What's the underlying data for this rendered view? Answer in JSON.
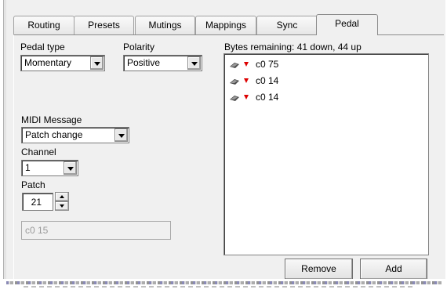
{
  "tabs": [
    {
      "label": "Routing",
      "active": false
    },
    {
      "label": "Presets",
      "active": false
    },
    {
      "label": "Mutings",
      "active": false
    },
    {
      "label": "Mappings",
      "active": false
    },
    {
      "label": "Sync",
      "active": false
    },
    {
      "label": "Pedal",
      "active": true
    }
  ],
  "pedal_type": {
    "label": "Pedal type",
    "value": "Momentary"
  },
  "polarity": {
    "label": "Polarity",
    "value": "Positive"
  },
  "midi_message": {
    "label": "MIDI Message",
    "value": "Patch change"
  },
  "channel": {
    "label": "Channel",
    "value": "1"
  },
  "patch": {
    "label": "Patch",
    "value": "21"
  },
  "output_preview": "c0 15",
  "bytes": {
    "label": "Bytes remaining: 41 down, 44 up",
    "items": [
      "c0 75",
      "c0 14",
      "c0 14"
    ]
  },
  "buttons": {
    "remove": "Remove",
    "add": "Add"
  },
  "icons": {
    "list_item": "pedal-icon",
    "direction": "down-arrow-icon"
  },
  "colors": {
    "down_arrow": "#dd0000",
    "panel": "#f0f0f0"
  }
}
